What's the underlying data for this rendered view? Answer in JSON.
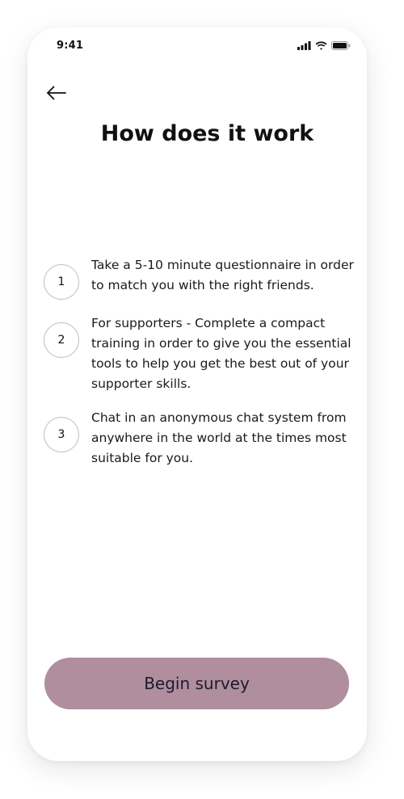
{
  "status_bar": {
    "time": "9:41",
    "icons": [
      "signal-icon",
      "wifi-icon",
      "battery-icon"
    ]
  },
  "header": {
    "back_icon": "arrow-left-icon",
    "title": "How does it work"
  },
  "steps": [
    {
      "number": "1",
      "text": "Take a 5-10 minute questionnaire in order to match you with the right friends."
    },
    {
      "number": "2",
      "text": "For supporters - Complete a compact training in order to give you the essential tools to help you get the best out of your supporter skills."
    },
    {
      "number": "3",
      "text": "Chat in an anonymous chat system from anywhere in the world at the times most suitable for you."
    }
  ],
  "cta": {
    "label": "Begin survey",
    "color": "#b08e9e"
  }
}
